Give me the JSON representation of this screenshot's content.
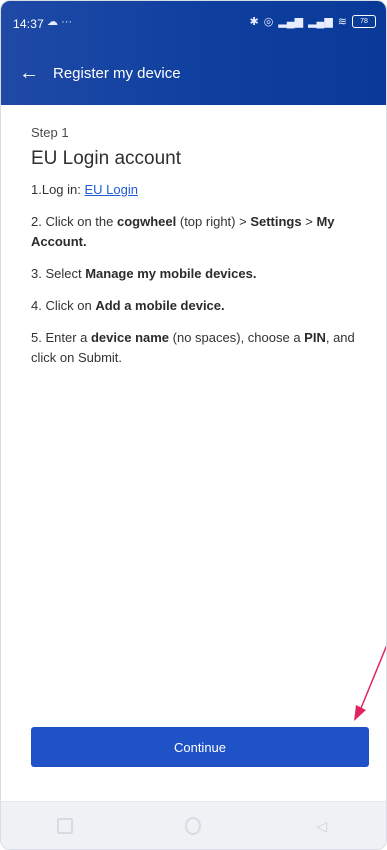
{
  "status_bar": {
    "time": "14:37",
    "left_icons": [
      "cloud-icon",
      "more-icon"
    ],
    "right_icons": [
      "bluetooth-icon",
      "alarm-icon",
      "signal-icon",
      "signal-icon",
      "wifi-icon",
      "battery-icon"
    ],
    "battery_level": "78"
  },
  "toolbar": {
    "title": "Register my device"
  },
  "content": {
    "step": "Step 1",
    "title": "EU Login account",
    "line1_prefix": "1.Log in: ",
    "line1_link": "EU Login",
    "line2_a": "2. Click on the ",
    "line2_b": "cogwheel",
    "line2_c": " (top right) > ",
    "line2_d": "Settings",
    "line2_e": " > ",
    "line2_f": "My Account.",
    "line3_a": "3. Select ",
    "line3_b": "Manage my mobile devices.",
    "line4_a": "4. Click on ",
    "line4_b": "Add a mobile device.",
    "line5_a": "5. Enter a ",
    "line5_b": "device name",
    "line5_c": " (no spaces), choose a ",
    "line5_d": "PIN",
    "line5_e": ", and click on Submit."
  },
  "continue_button": "Continue",
  "colors": {
    "primary": "#1f52c6",
    "appbar": "#0e3f9f",
    "link": "#1e5bd6",
    "annotation_arrow": "#e0245e"
  }
}
